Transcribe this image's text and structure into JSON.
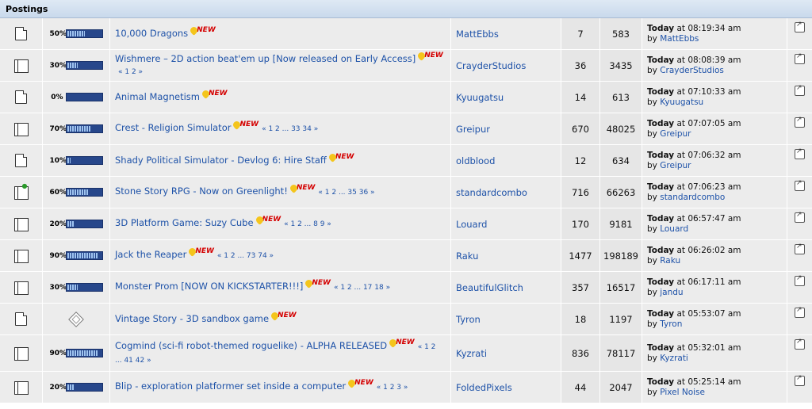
{
  "header": {
    "title": "Postings"
  },
  "rows": [
    {
      "title": "10,000 Dragons",
      "pages": "",
      "author": "MattEbbs",
      "replies": "7",
      "views": "583",
      "when": "Today",
      "time": " at 08:19:34 am",
      "by": "by ",
      "last_author": "MattEbbs",
      "pct": "50%",
      "fill": 0.5,
      "icon": "doc"
    },
    {
      "title": "Wishmere – 2D action beat'em up [Now released on Early Access]",
      "pages": "« 1 2 »",
      "author": "CrayderStudios",
      "replies": "36",
      "views": "3435",
      "when": "Today",
      "time": " at 08:08:39 am",
      "by": "by ",
      "last_author": "CrayderStudios",
      "pct": "30%",
      "fill": 0.3,
      "icon": "doc-multi"
    },
    {
      "title": "Animal Magnetism",
      "pages": "",
      "author": "Kyuugatsu",
      "replies": "14",
      "views": "613",
      "when": "Today",
      "time": " at 07:10:33 am",
      "by": "by ",
      "last_author": "Kyuugatsu",
      "pct": "0%",
      "fill": 0,
      "icon": "doc"
    },
    {
      "title": "Crest - Religion Simulator",
      "pages": "« 1 2 ... 33 34 »",
      "author": "Greipur",
      "replies": "670",
      "views": "48025",
      "when": "Today",
      "time": " at 07:07:05 am",
      "by": "by ",
      "last_author": "Greipur",
      "pct": "70%",
      "fill": 0.7,
      "icon": "doc-multi"
    },
    {
      "title": "Shady Political Simulator - Devlog 6: Hire Staff",
      "pages": "",
      "author": "oldblood",
      "replies": "12",
      "views": "634",
      "when": "Today",
      "time": " at 07:06:32 am",
      "by": "by ",
      "last_author": "Greipur",
      "pct": "10%",
      "fill": 0.1,
      "icon": "doc"
    },
    {
      "title": "Stone Story RPG - Now on Greenlight!",
      "pages": "« 1 2 ... 35 36 »",
      "author": "standardcombo",
      "replies": "716",
      "views": "66263",
      "when": "Today",
      "time": " at 07:06:23 am",
      "by": "by ",
      "last_author": "standardcombo",
      "pct": "60%",
      "fill": 0.6,
      "icon": "doc-multi-sticky"
    },
    {
      "title": "3D Platform Game: Suzy Cube",
      "pages": "« 1 2 ... 8 9 »",
      "author": "Louard",
      "replies": "170",
      "views": "9181",
      "when": "Today",
      "time": " at 06:57:47 am",
      "by": "by ",
      "last_author": "Louard",
      "pct": "20%",
      "fill": 0.2,
      "icon": "doc-multi"
    },
    {
      "title": "Jack the Reaper",
      "pages": "« 1 2 ... 73 74 »",
      "author": "Raku",
      "replies": "1477",
      "views": "198189",
      "when": "Today",
      "time": " at 06:26:02 am",
      "by": "by ",
      "last_author": "Raku",
      "pct": "90%",
      "fill": 0.9,
      "icon": "doc-multi"
    },
    {
      "title": "Monster Prom [NOW ON KICKSTARTER!!!]",
      "pages": "« 1 2 ... 17 18 »",
      "author": "BeautifulGlitch",
      "replies": "357",
      "views": "16517",
      "when": "Today",
      "time": " at 06:17:11 am",
      "by": "by ",
      "last_author": "jandu",
      "pct": "30%",
      "fill": 0.3,
      "icon": "doc-multi"
    },
    {
      "title": "Vintage Story - 3D sandbox game",
      "pages": "",
      "author": "Tyron",
      "replies": "18",
      "views": "1197",
      "when": "Today",
      "time": " at 05:53:07 am",
      "by": "by ",
      "last_author": "Tyron",
      "pct": "",
      "fill": null,
      "icon": "doc"
    },
    {
      "title": "Cogmind (sci-fi robot-themed roguelike) - ALPHA RELEASED",
      "pages": "« 1 2 ... 41 42 »",
      "author": "Kyzrati",
      "replies": "836",
      "views": "78117",
      "when": "Today",
      "time": " at 05:32:01 am",
      "by": "by ",
      "last_author": "Kyzrati",
      "pct": "90%",
      "fill": 0.9,
      "icon": "doc-multi",
      "tall": true
    },
    {
      "title": "Blip - exploration platformer set inside a computer",
      "pages": "« 1 2 3 »",
      "author": "FoldedPixels",
      "replies": "44",
      "views": "2047",
      "when": "Today",
      "time": " at 05:25:14 am",
      "by": "by ",
      "last_author": "Pixel Noise",
      "pct": "20%",
      "fill": 0.2,
      "icon": "doc-multi"
    }
  ],
  "labels": {
    "new_badge": "NEW"
  },
  "colors": {
    "link": "#1e52a8",
    "new": "#d40000",
    "bar": "#27478b",
    "bar_fill": "#9fc4f0"
  },
  "icons": {
    "thread": "document-icon",
    "hot_thread": "multi-page-document-icon",
    "moved": "diamond-icon",
    "jump": "jump-to-last-post-icon"
  }
}
